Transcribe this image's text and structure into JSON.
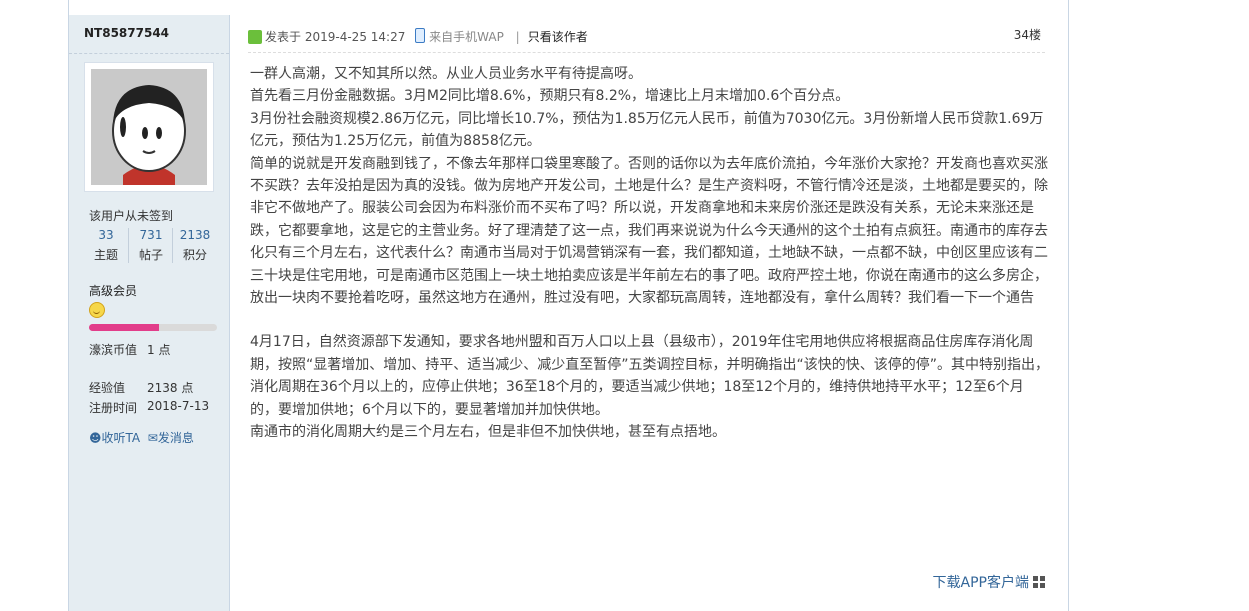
{
  "user": {
    "name": "NT85877544",
    "signin_status": "该用户从未签到",
    "stats": [
      {
        "value": "33",
        "label": "主题"
      },
      {
        "value": "731",
        "label": "帖子"
      },
      {
        "value": "2138",
        "label": "积分"
      }
    ],
    "rank": "高级会员",
    "rank_progress": 0.55,
    "currency_label": "濠滨币值",
    "currency_value": "1 点",
    "exp_label": "经验值",
    "exp_value": "2138 点",
    "reg_label": "注册时间",
    "reg_value": "2018-7-13",
    "follow_label": "收听TA",
    "message_label": "发消息"
  },
  "post": {
    "posted_prefix": "发表于",
    "posted_time": "2019-4-25 14:27",
    "source": "来自手机WAP",
    "only_author": "只看该作者",
    "floor": "34楼",
    "paragraphs": [
      "一群人高潮，又不知其所以然。从业人员业务水平有待提高呀。",
      "首先看三月份金融数据。3月M2同比增8.6%，预期只有8.2%，增速比上月末增加0.6个百分点。",
      "3月份社会融资规模2.86万亿元，同比增长10.7%，预估为1.85万亿元人民币，前值为7030亿元。3月份新增人民币贷款1.69万亿元，预估为1.25万亿元，前值为8858亿元。",
      "简单的说就是开发商融到钱了，不像去年那样口袋里寒酸了。否则的话你以为去年底价流拍，今年涨价大家抢？开发商也喜欢买涨不买跌？去年没拍是因为真的没钱。做为房地产开发公司，土地是什么？是生产资料呀，不管行情冷还是淡，土地都是要买的，除非它不做地产了。服装公司会因为布料涨价而不买布了吗？所以说，开发商拿地和未来房价涨还是跌没有关系，无论未来涨还是跌，它都要拿地，这是它的主营业务。好了理清楚了这一点，我们再来说说为什么今天通州的这个土拍有点疯狂。南通市的库存去化只有三个月左右，这代表什么？南通市当局对于饥渴营销深有一套，我们都知道，土地缺不缺，一点都不缺，中创区里应该有二三十块是住宅用地，可是南通市区范围上一块土地拍卖应该是半年前左右的事了吧。政府严控土地，你说在南通市的这么多房企，放出一块肉不要抢着吃呀，虽然这地方在通州，胜过没有吧，大家都玩高周转，连地都没有，拿什么周转？我们看一下一个通告",
      "",
      "4月17日，自然资源部下发通知，要求各地州盟和百万人口以上县（县级市），2019年住宅用地供应将根据商品住房库存消化周期，按照“显著增加、增加、持平、适当减少、减少直至暂停”五类调控目标，并明确指出“该快的快、该停的停”。其中特别指出，消化周期在36个月以上的，应停止供地；36至18个月的，要适当减少供地；18至12个月的，维持供地持平水平；12至6个月的，要增加供地；6个月以下的，要显著增加并加快供地。",
      "南通市的消化周期大约是三个月左右，但是非但不加快供地，甚至有点捂地。"
    ],
    "app_link": "下载APP客户端"
  },
  "colors": {
    "accent": "#336699",
    "sidebar_bg": "#e5edf2",
    "progress": "#e23d8a"
  }
}
